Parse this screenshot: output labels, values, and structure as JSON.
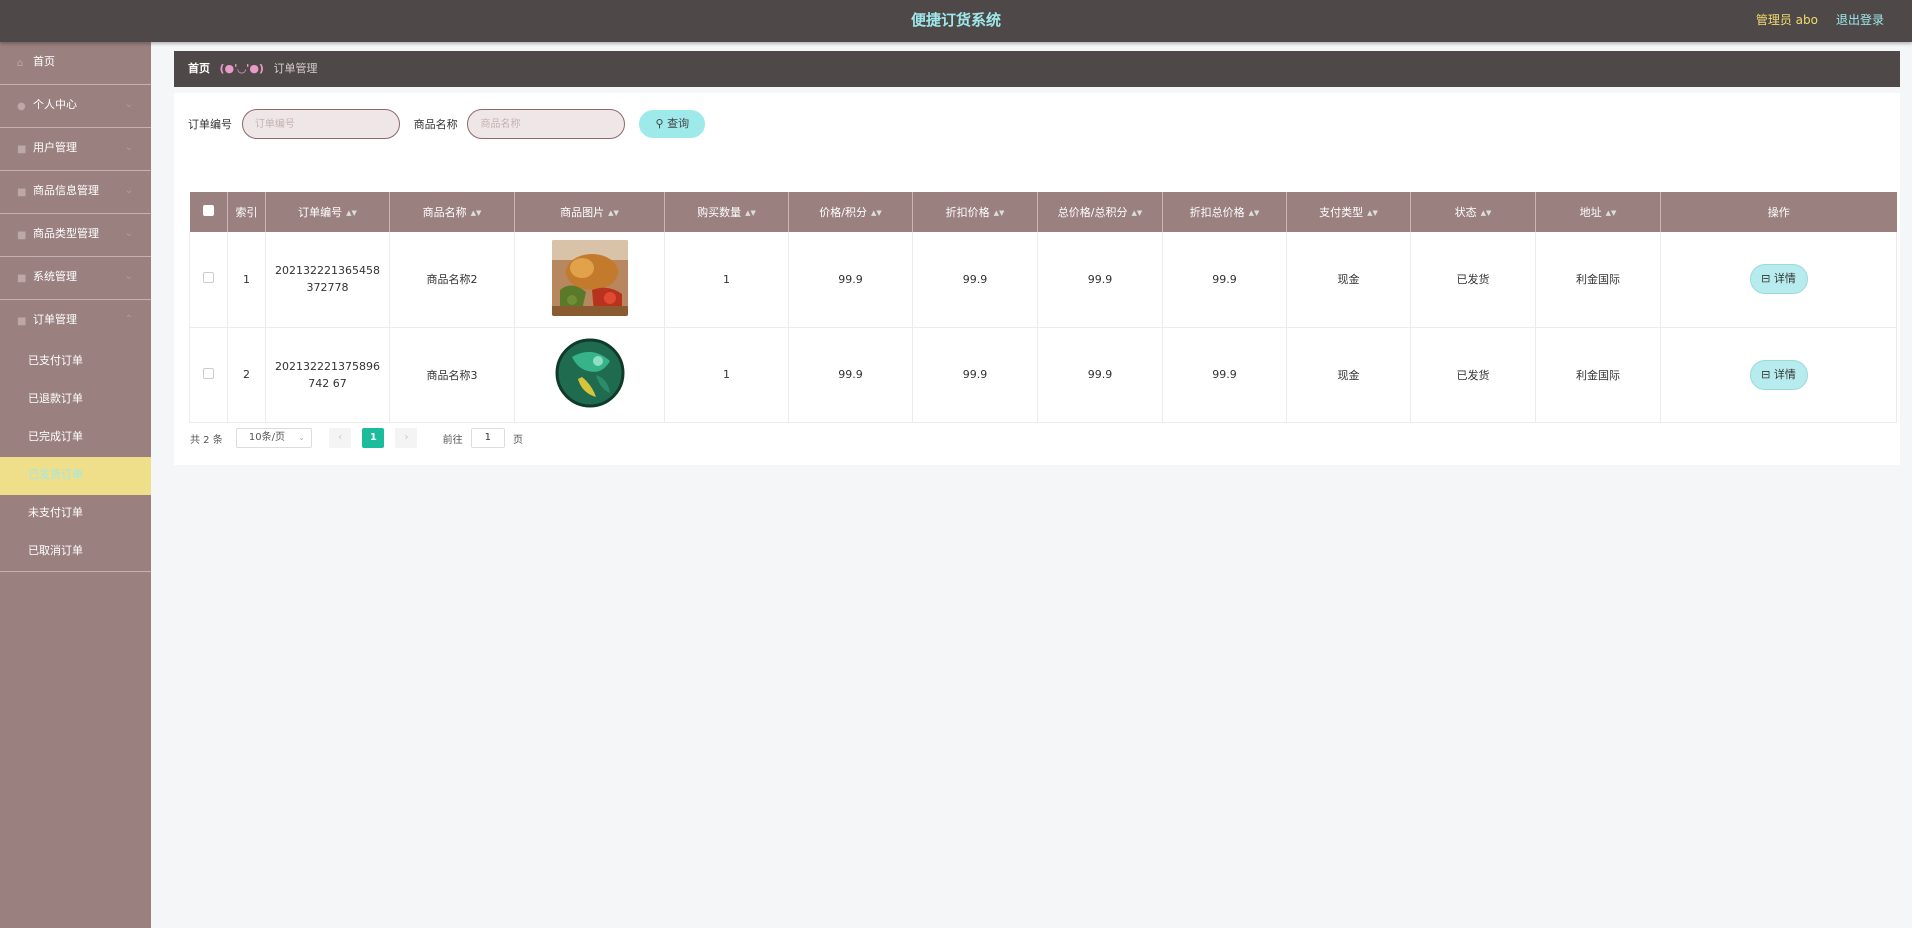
{
  "header": {
    "title": "便捷订货系统",
    "admin_label": "管理员 abo",
    "logout_label": "退出登录"
  },
  "sidebar": {
    "items": [
      {
        "label": "首页",
        "icon": "home-icon"
      },
      {
        "label": "个人中心",
        "icon": "user-icon"
      },
      {
        "label": "用户管理",
        "icon": "users-icon"
      },
      {
        "label": "商品信息管理",
        "icon": "goods-icon"
      },
      {
        "label": "商品类型管理",
        "icon": "category-icon"
      },
      {
        "label": "系统管理",
        "icon": "settings-icon"
      },
      {
        "label": "订单管理",
        "icon": "order-icon"
      }
    ],
    "sub_items": [
      {
        "label": "已支付订单"
      },
      {
        "label": "已退款订单"
      },
      {
        "label": "已完成订单"
      },
      {
        "label": "已发货订单"
      },
      {
        "label": "未支付订单"
      },
      {
        "label": "已取消订单"
      }
    ],
    "active_sub_index": 3
  },
  "breadcrumb": {
    "home": "首页",
    "sep": "(●'◡'●)",
    "current": "订单管理"
  },
  "search": {
    "order_no_label": "订单编号",
    "order_no_placeholder": "订单编号",
    "product_name_label": "商品名称",
    "product_name_placeholder": "商品名称",
    "button_label": "查询"
  },
  "table": {
    "columns": [
      "索引",
      "订单编号",
      "商品名称",
      "商品图片",
      "购买数量",
      "价格/积分",
      "折扣价格",
      "总价格/总积分",
      "折扣总价格",
      "支付类型",
      "状态",
      "地址",
      "操作"
    ],
    "rows": [
      {
        "index": "1",
        "order_no": "202132221365458372778",
        "product": "商品名称2",
        "image": "food-photo",
        "qty": "1",
        "price": "99.9",
        "discount_price": "99.9",
        "total": "99.9",
        "discount_total": "99.9",
        "pay_type": "现金",
        "status": "已发货",
        "address": "利金国际",
        "action": "详情"
      },
      {
        "index": "2",
        "order_no": "202132221375896742 67",
        "product": "商品名称3",
        "image": "ball-photo",
        "qty": "1",
        "price": "99.9",
        "discount_price": "99.9",
        "total": "99.9",
        "discount_total": "99.9",
        "pay_type": "现金",
        "status": "已发货",
        "address": "利金国际",
        "action": "详情"
      }
    ]
  },
  "pagination": {
    "total_text": "共 2 条",
    "page_size": "10条/页",
    "current_page": "1",
    "goto_label": "前往",
    "goto_value": "1",
    "page_suffix": "页"
  },
  "colors": {
    "topbar": "#4f4848",
    "sidebar": "#9a8180",
    "accent_cyan": "#9ee9ea",
    "active_yellow": "#efdf8b",
    "pager_active": "#1abc9c"
  }
}
